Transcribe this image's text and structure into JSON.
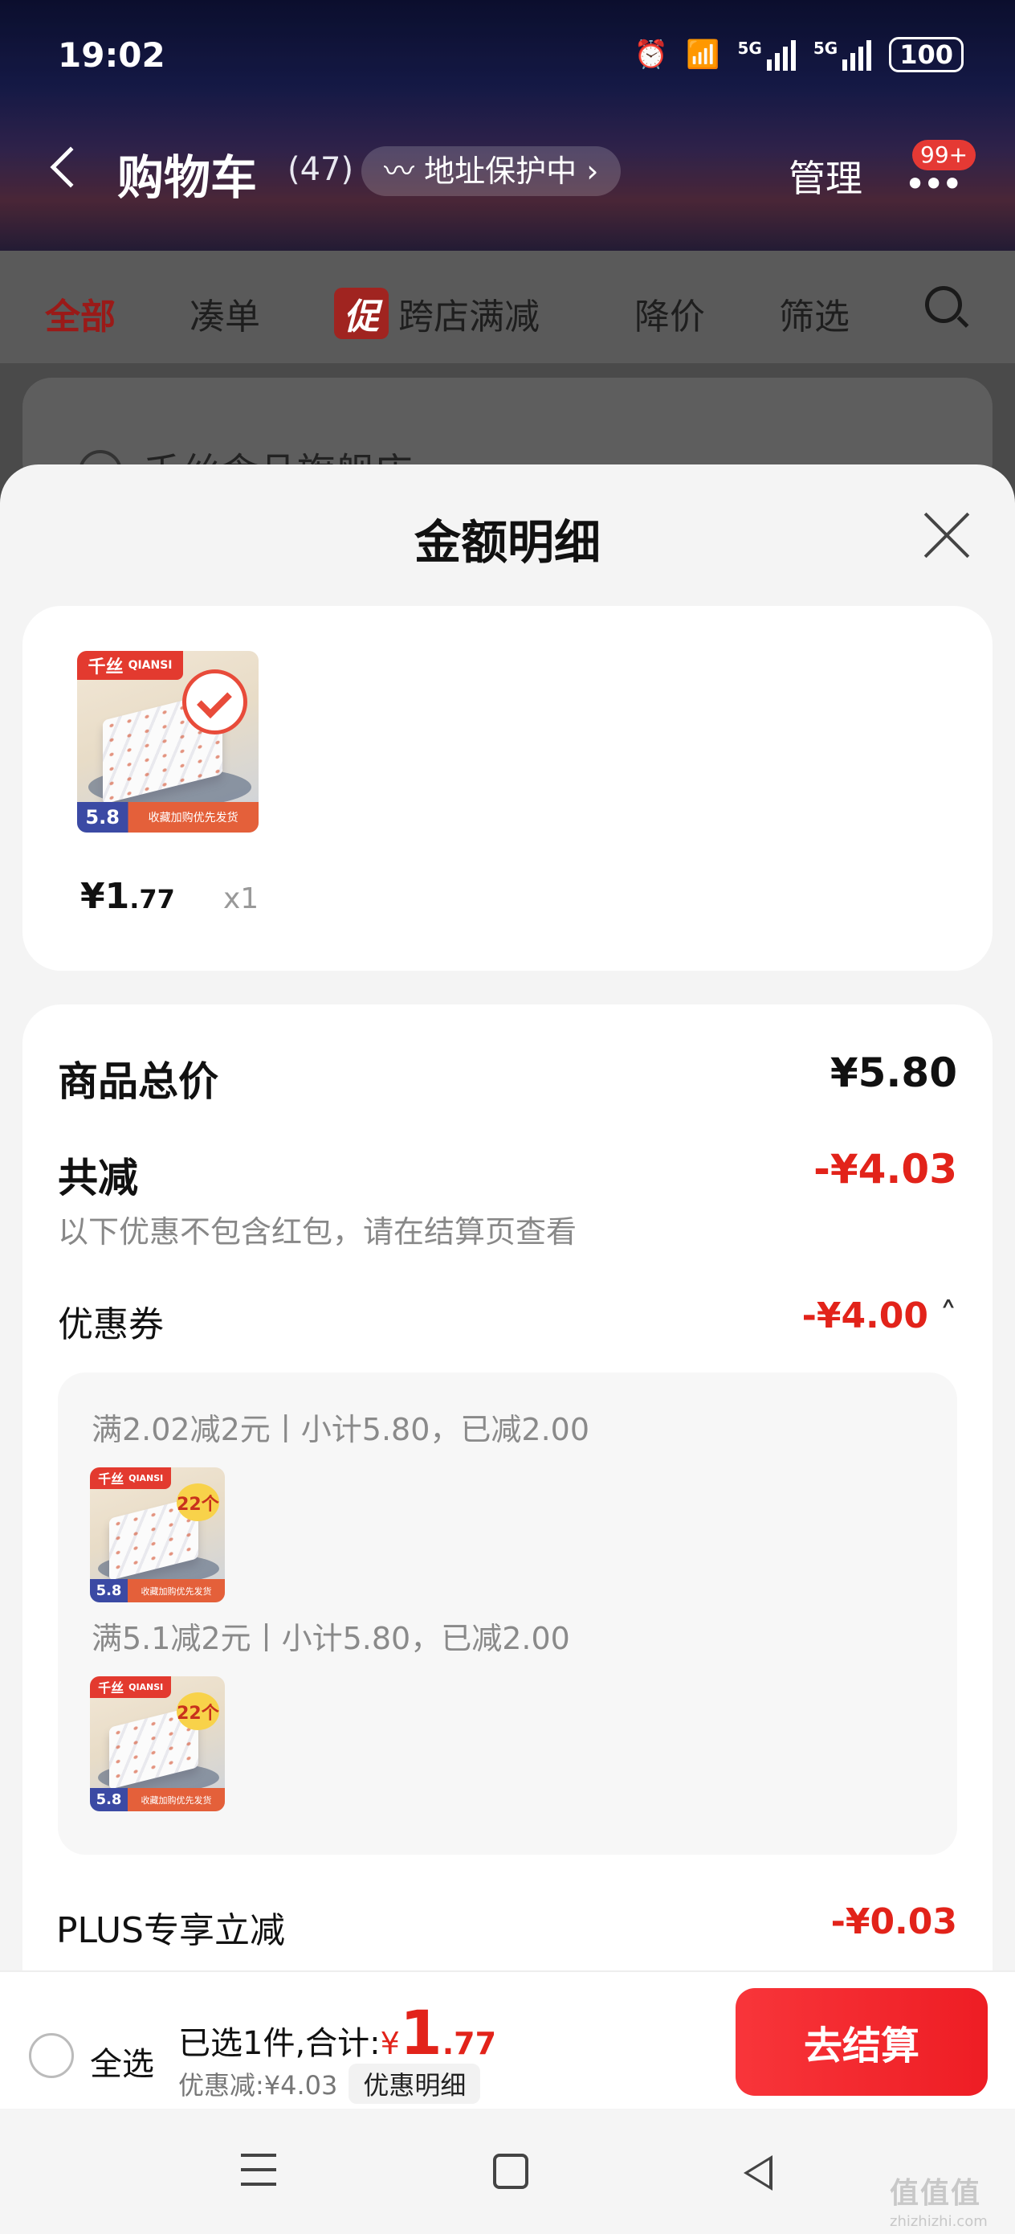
{
  "status_bar": {
    "time": "19:02",
    "battery": "100",
    "network": "5G"
  },
  "header": {
    "title": "购物车",
    "count": "(47)",
    "address_protect": "地址保护中",
    "manage": "管理",
    "badge": "99+"
  },
  "tabs": {
    "all": "全部",
    "bundle": "凑单",
    "promo_tag": "促",
    "cross_store": "跨店满减",
    "price_drop": "降价",
    "filter": "筛选"
  },
  "store_peek": {
    "name": "千丝食品旗舰店 ›"
  },
  "sheet": {
    "title": "金额明细",
    "item": {
      "price_main": "¥1",
      "price_dec": ".77",
      "qty": "x1"
    },
    "summary": {
      "goods_total_label": "商品总价",
      "goods_total_value": "¥5.80",
      "total_discount_label": "共减",
      "total_discount_value": "-¥4.03",
      "note": "以下优惠不包含红包，请在结算页查看",
      "coupon_label": "优惠券",
      "coupon_value": "-¥4.00",
      "coupon_rules": [
        {
          "text": "满2.02减2元丨小计5.80，已减2.00"
        },
        {
          "text": "满5.1减2元丨小计5.80，已减2.00"
        }
      ],
      "plus_label": "PLUS专享立减",
      "plus_value": "-¥0.03"
    }
  },
  "thumb": {
    "brand_cn": "千丝",
    "brand_en": "QIANSI",
    "price_tag": "5.8",
    "promo_text": "收藏加购优先发货",
    "count_tag": "22个"
  },
  "bottom_bar": {
    "select_all": "全选",
    "selected_prefix": "已选1件,合计:",
    "yen": "¥",
    "total_int": "1",
    "total_dec": ".77",
    "discount": "优惠减:¥4.03",
    "detail_btn": "优惠明细",
    "checkout": "去结算"
  },
  "watermark": {
    "main": "值值值",
    "sub": "zhizhizhi.com"
  }
}
